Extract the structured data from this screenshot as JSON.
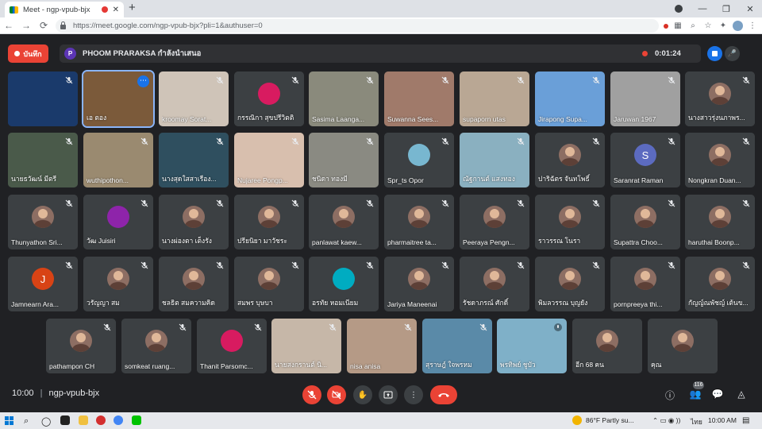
{
  "browser": {
    "tab_title": "Meet - ngp-vpub-bjx",
    "tab_close": "✕",
    "new_tab": "+",
    "url": "https://meet.google.com/ngp-vpub-bjx?pli=1&authuser=0",
    "window_controls": [
      "—",
      "❐",
      "✕"
    ]
  },
  "meet": {
    "record_label": "บันทึก",
    "presenter_initial": "P",
    "presenter_text": "PHOOM PRARAKSA กำลังนำเสนอ",
    "timer": "0:01:24",
    "meeting_time": "10:00",
    "meeting_code": "ngp-vpub-bjx",
    "participants_badge": "116"
  },
  "tiles": [
    {
      "name": "",
      "bg": "#1a3a6b",
      "mic": "off"
    },
    {
      "name": "เอ ตอง",
      "bg": "#7b5a3a",
      "mic": "on",
      "active": true,
      "more": true
    },
    {
      "name": "kroomay Sorat...",
      "bg": "#cfc4b8",
      "mic": "off"
    },
    {
      "name": "กรรณิกา สุขปรีวิตติ",
      "bg": "#3c4043",
      "mic": "off",
      "avatar": "#d81b60"
    },
    {
      "name": "Sasima Laanga...",
      "bg": "#8a8a7c",
      "mic": "off"
    },
    {
      "name": "Suwanna Sees...",
      "bg": "#a07a6a",
      "mic": "off"
    },
    {
      "name": "supaporn utas",
      "bg": "#b9a794",
      "mic": "off"
    },
    {
      "name": "Jirapong Supa...",
      "bg": "#6a9fd8",
      "mic": "off"
    },
    {
      "name": "Jaruwan 1967",
      "bg": "#a0a0a0",
      "mic": "off"
    },
    {
      "name": "นางสาวรุ่งนภาพร...",
      "bg": "#3c4043",
      "mic": "off",
      "avatar": "photo"
    },
    {
      "name": "นายธวัฒน์ มีตรี",
      "bg": "#4a5a4a",
      "mic": "off"
    },
    {
      "name": "wuthipothon...",
      "bg": "#9a8a70",
      "mic": "off"
    },
    {
      "name": "นางสุดใสสาเรือง...",
      "bg": "#2f4f5f",
      "mic": "off"
    },
    {
      "name": "Nujaree Pongp...",
      "bg": "#d8bfae",
      "mic": "off"
    },
    {
      "name": "ชนิดา ทองมี",
      "bg": "#8a8a82",
      "mic": "off"
    },
    {
      "name": "Spr_ts Opor",
      "bg": "#3c4043",
      "mic": "off",
      "avatar": "#78b7d0"
    },
    {
      "name": "ณัฐกานต์ แสงทอง",
      "bg": "#8ab0c0",
      "mic": "off"
    },
    {
      "name": "ปาริฉัตร จันทโพธิ์",
      "bg": "#3c4043",
      "mic": "off",
      "avatar": "photo"
    },
    {
      "name": "Saranrat Raman",
      "bg": "#3c4043",
      "mic": "off",
      "avatar": "#5c6bc0",
      "letter": "S"
    },
    {
      "name": "Nongkran Duan...",
      "bg": "#3c4043",
      "mic": "off",
      "avatar": "photo"
    },
    {
      "name": "Thunyathon Sri...",
      "bg": "#3c4043",
      "mic": "off",
      "avatar": "photo"
    },
    {
      "name": "วัฒ Juisiri",
      "bg": "#3c4043",
      "mic": "off",
      "avatar": "#8e24aa"
    },
    {
      "name": "นางผ่องตา เต็งรัง",
      "bg": "#3c4043",
      "mic": "off",
      "avatar": "photo"
    },
    {
      "name": "ปรียนิยา มาวัชระ",
      "bg": "#3c4043",
      "mic": "off",
      "avatar": "photo"
    },
    {
      "name": "panlawat kaew...",
      "bg": "#3c4043",
      "mic": "off",
      "avatar": "photo"
    },
    {
      "name": "pharmaitree ta...",
      "bg": "#3c4043",
      "mic": "off",
      "avatar": "photo"
    },
    {
      "name": "Peeraya Pengn...",
      "bg": "#3c4043",
      "mic": "off",
      "avatar": "photo"
    },
    {
      "name": "ราวรรณ โนรา",
      "bg": "#3c4043",
      "mic": "off",
      "avatar": "photo"
    },
    {
      "name": "Supattra Choo...",
      "bg": "#3c4043",
      "mic": "off",
      "avatar": "photo"
    },
    {
      "name": "haruthai Boonp...",
      "bg": "#3c4043",
      "mic": "off",
      "avatar": "photo"
    },
    {
      "name": "Jamnearn Ara...",
      "bg": "#3c4043",
      "mic": "off",
      "avatar": "#d84315",
      "letter": "J"
    },
    {
      "name": "วรัญญา สม",
      "bg": "#3c4043",
      "mic": "off",
      "avatar": "photo"
    },
    {
      "name": "ชลธิต สมความคิด",
      "bg": "#3c4043",
      "mic": "off",
      "avatar": "photo"
    },
    {
      "name": "สมพร บุษบา",
      "bg": "#3c4043",
      "mic": "off",
      "avatar": "photo"
    },
    {
      "name": "อรทัย หอมเนียม",
      "bg": "#3c4043",
      "mic": "off",
      "avatar": "#00acc1"
    },
    {
      "name": "Jariya Maneenai",
      "bg": "#3c4043",
      "mic": "off",
      "avatar": "photo"
    },
    {
      "name": "รัชดาภรณ์ ศักดิ์",
      "bg": "#3c4043",
      "mic": "off",
      "avatar": "photo"
    },
    {
      "name": "พิมลวรรณ บุญยัง",
      "bg": "#3c4043",
      "mic": "off",
      "avatar": "photo"
    },
    {
      "name": "pornpreeya thi...",
      "bg": "#3c4043",
      "mic": "off",
      "avatar": "photo"
    },
    {
      "name": "กัญญ์ณพัชญ์ เต้นข...",
      "bg": "#3c4043",
      "mic": "off",
      "avatar": "photo"
    },
    {
      "name": "pathampon CH",
      "bg": "#3c4043",
      "mic": "off",
      "avatar": "photo"
    },
    {
      "name": "somkeat ruang...",
      "bg": "#3c4043",
      "mic": "off",
      "avatar": "photo"
    },
    {
      "name": "Thanit Parsomc...",
      "bg": "#3c4043",
      "mic": "off",
      "avatar": "#d81b60"
    },
    {
      "name": "นายสงกรานต์ นิ...",
      "bg": "#c6b7a8",
      "mic": "off"
    },
    {
      "name": "nisa anisa",
      "bg": "#b59a86",
      "mic": "off"
    },
    {
      "name": "สุราษฎ์ ใจพรหม",
      "bg": "#5a8aa8",
      "mic": "off"
    },
    {
      "name": "พรทิพย์ ชูบัว",
      "bg": "#7fb0c8",
      "mic": "on"
    },
    {
      "name": "อีก 68 คน",
      "bg": "#3c4043",
      "mic": "none",
      "avatar": "photo"
    },
    {
      "name": "คุณ",
      "bg": "#3c4043",
      "mic": "none",
      "avatar": "photo"
    }
  ],
  "taskbar": {
    "weather": "86°F  Partly su...",
    "lang": "ไทย",
    "clock": "10:00 AM"
  }
}
